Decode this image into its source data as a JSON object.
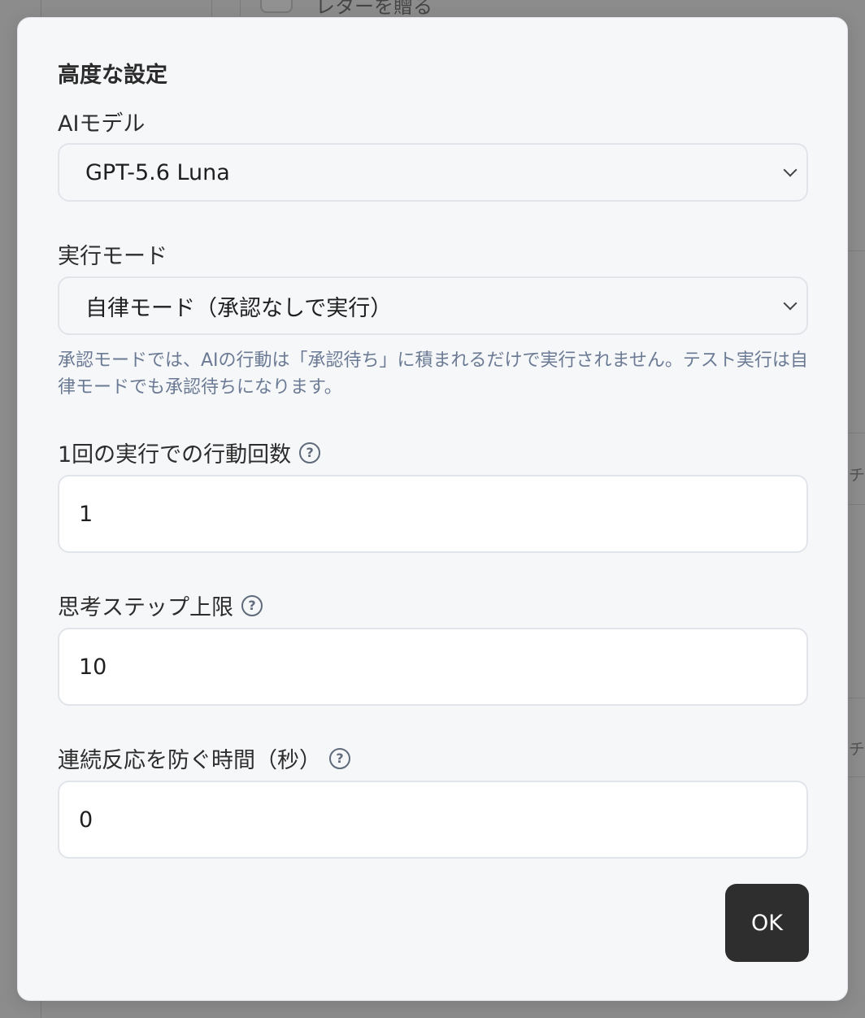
{
  "background": {
    "peek_text": "レターを贈る",
    "edge_text_1": "チ",
    "edge_text_2": "チ"
  },
  "modal": {
    "title": "高度な設定",
    "ai_model": {
      "label": "AIモデル",
      "selected": "GPT-5.6 Luna"
    },
    "run_mode": {
      "label": "実行モード",
      "selected": "自律モード（承認なしで実行）",
      "hint": "承認モードでは、AIの行動は「承認待ち」に積まれるだけで実行されません。テスト実行は自律モードでも承認待ちになります。"
    },
    "actions_per_run": {
      "label": "1回の実行での行動回数",
      "value": "1"
    },
    "thinking_steps": {
      "label": "思考ステップ上限",
      "value": "10"
    },
    "cooldown": {
      "label": "連続反応を防ぐ時間（秒）",
      "value": "0"
    },
    "ok_label": "OK"
  },
  "colors": {
    "overlay": "#8c8c8c",
    "modal_bg": "#f6f7f9",
    "hint_text": "#6b7a94",
    "primary_button": "#2e2e2e"
  }
}
